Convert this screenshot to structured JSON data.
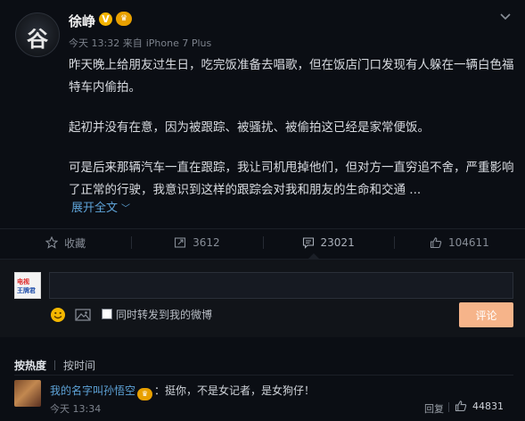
{
  "post": {
    "author": "徐峥",
    "verified_badge": "V",
    "member_badge": "♛",
    "timestamp": "今天 13:32",
    "source_prefix": "来自",
    "device": "iPhone 7 Plus",
    "avatar_glyph": "谷",
    "paragraphs": [
      "昨天晚上给朋友过生日，吃完饭准备去唱歌，但在饭店门口发现有人躲在一辆白色福特车内偷拍。",
      "起初并没有在意，因为被跟踪、被骚扰、被偷拍这已经是家常便饭。",
      "可是后来那辆汽车一直在跟踪，我让司机甩掉他们，但对方一直穷追不舍，严重影响了正常的行驶，我意识到这样的跟踪会对我和朋友的生命和交通 ..."
    ],
    "expand_label": "展开全文"
  },
  "actions": {
    "favorite": "收藏",
    "repost": "3612",
    "comment": "23021",
    "like": "104611"
  },
  "composer": {
    "input_value": "",
    "avatar_line1": "电视",
    "avatar_line2": "王牌君",
    "repost_checkbox_label": "同时转发到我的微博",
    "submit_label": "评论"
  },
  "sort": {
    "by_hot": "按热度",
    "by_time": "按时间"
  },
  "comment": {
    "user": "我的名字叫孙悟空",
    "member_badge": "♛",
    "text": "：挺你，不是女记者，是女狗仔！",
    "time": "今天 13:34",
    "reply_label": "回复",
    "likes": "44831"
  },
  "colors": {
    "background": "#0b0e14",
    "link": "#5ea3d8",
    "submit": "#f6b48a",
    "verified": "#f4b400"
  }
}
